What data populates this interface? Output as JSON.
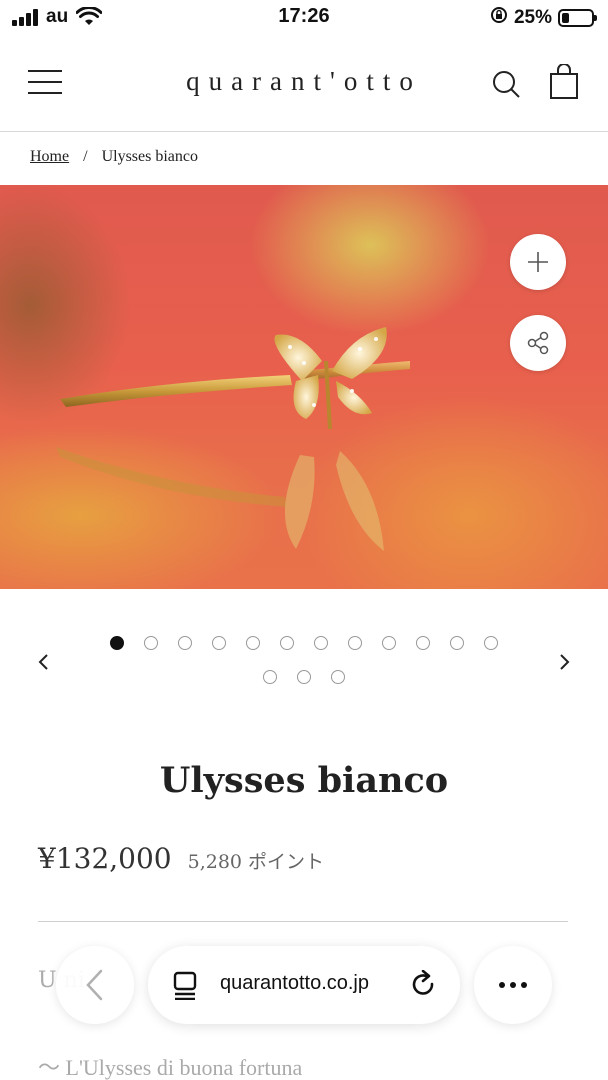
{
  "status_bar": {
    "carrier": "au",
    "time": "17:26",
    "battery_percent": "25%",
    "battery_level": 0.25
  },
  "header": {
    "logo": "quarant'otto",
    "icons": [
      "hamburger-menu-icon",
      "search-icon",
      "shopping-bag-icon"
    ]
  },
  "breadcrumb": {
    "home": "Home",
    "separator": "/",
    "current": "Ulysses bianco"
  },
  "gallery": {
    "total_images": 15,
    "active_index": 0,
    "buttons": [
      "zoom-plus-icon",
      "share-icon"
    ],
    "arrows": [
      "chevron-left-icon",
      "chevron-right-icon"
    ]
  },
  "product": {
    "title": "Ulysses bianco",
    "price": "¥132,000",
    "points": "5,280 ポイント",
    "description_partial": "U      ni",
    "subtitle": "〜 L'Ulysses di buona fortuna"
  },
  "browser": {
    "url": "quarantotto.co.jp",
    "icons": [
      "back-arrow-icon",
      "tabs-icon",
      "reload-icon",
      "more-icon"
    ]
  },
  "colors": {
    "accent_dark": "#111111",
    "divider": "#cfcfcf",
    "hero_red": "#e05a4e"
  }
}
